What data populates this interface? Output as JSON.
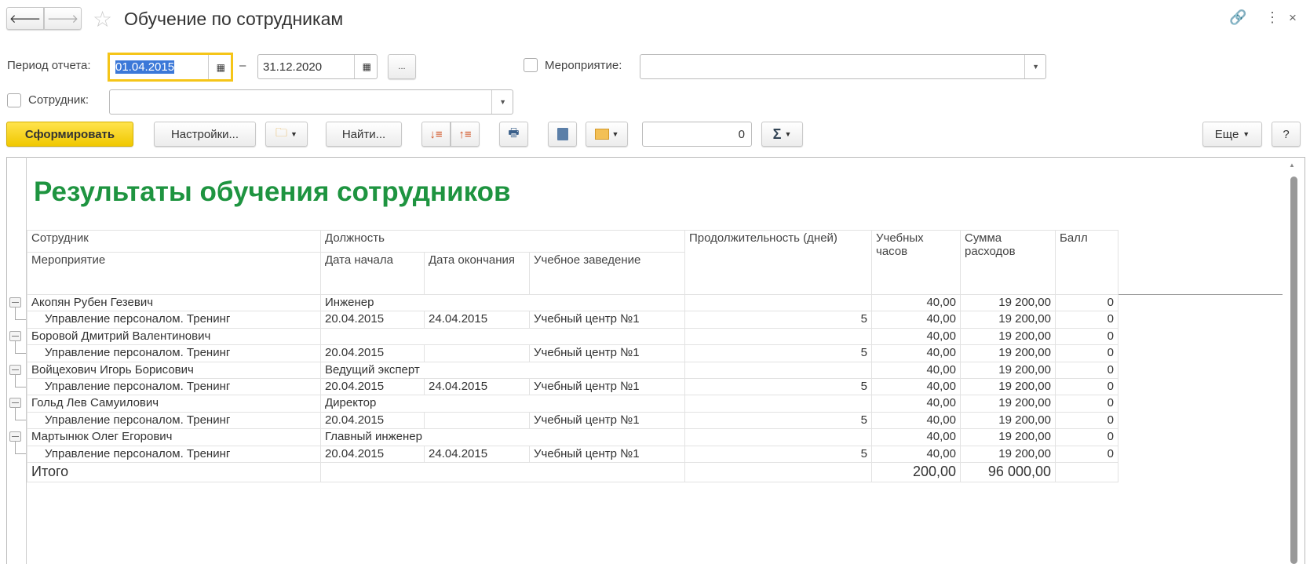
{
  "window": {
    "title": "Обучение по сотрудникам"
  },
  "filters": {
    "period_label": "Период отчета:",
    "date_from": "01.04.2015",
    "date_to": "31.12.2020",
    "dash": "–",
    "period_button": "...",
    "event_label": "Мероприятие:",
    "event_value": "",
    "employee_label": "Сотрудник:",
    "employee_value": ""
  },
  "toolbar": {
    "generate": "Сформировать",
    "settings": "Настройки...",
    "find": "Найти...",
    "sum_value": "0",
    "more": "Еще",
    "help": "?"
  },
  "report": {
    "title": "Результаты обучения сотрудников",
    "headers": {
      "employee": "Сотрудник",
      "position": "Должность",
      "duration": "Продолжительность (дней)",
      "hours": "Учебных часов",
      "cost": "Сумма расходов",
      "score": "Балл",
      "event": "Мероприятие",
      "start": "Дата начала",
      "end": "Дата окончания",
      "institution": "Учебное заведение"
    },
    "rows": [
      {
        "name": "Акопян Рубен Гезевич",
        "position": "Инженер",
        "hours": "40,00",
        "cost": "19 200,00",
        "score": "0",
        "event": "Управление персоналом. Тренинг",
        "start": "20.04.2015",
        "end": "24.04.2015",
        "institution": "Учебный центр №1",
        "duration": "5",
        "ehours": "40,00",
        "ecost": "19 200,00",
        "escore": "0"
      },
      {
        "name": "Боровой Дмитрий Валентинович",
        "position": "",
        "hours": "40,00",
        "cost": "19 200,00",
        "score": "0",
        "event": "Управление персоналом. Тренинг",
        "start": "20.04.2015",
        "end": "",
        "institution": "Учебный центр №1",
        "duration": "5",
        "ehours": "40,00",
        "ecost": "19 200,00",
        "escore": "0"
      },
      {
        "name": "Войцехович Игорь Борисович",
        "position": "Ведущий эксперт",
        "hours": "40,00",
        "cost": "19 200,00",
        "score": "0",
        "event": "Управление персоналом. Тренинг",
        "start": "20.04.2015",
        "end": "24.04.2015",
        "institution": "Учебный центр №1",
        "duration": "5",
        "ehours": "40,00",
        "ecost": "19 200,00",
        "escore": "0"
      },
      {
        "name": "Гольд Лев Самуилович",
        "position": "Директор",
        "hours": "40,00",
        "cost": "19 200,00",
        "score": "0",
        "event": "Управление персоналом. Тренинг",
        "start": "20.04.2015",
        "end": "",
        "institution": "Учебный центр №1",
        "duration": "5",
        "ehours": "40,00",
        "ecost": "19 200,00",
        "escore": "0"
      },
      {
        "name": "Мартынюк Олег Егорович",
        "position": "Главный инженер",
        "hours": "40,00",
        "cost": "19 200,00",
        "score": "0",
        "event": "Управление персоналом. Тренинг",
        "start": "20.04.2015",
        "end": "24.04.2015",
        "institution": "Учебный центр №1",
        "duration": "5",
        "ehours": "40,00",
        "ecost": "19 200,00",
        "escore": "0"
      }
    ],
    "total": {
      "label": "Итого",
      "hours": "200,00",
      "cost": "96 000,00"
    }
  }
}
